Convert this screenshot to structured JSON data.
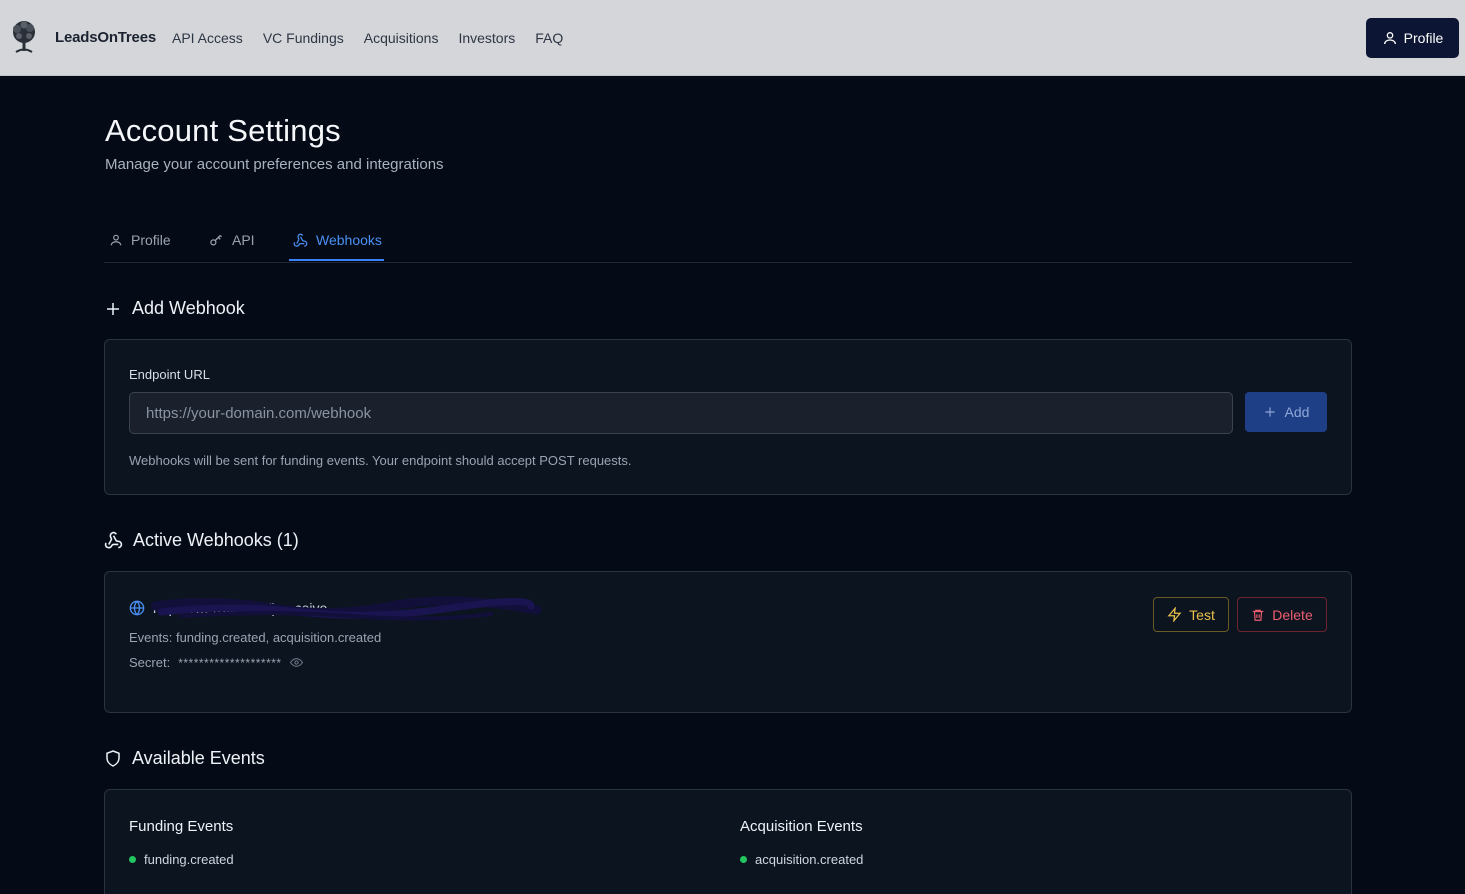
{
  "nav": {
    "brand": "LeadsOnTrees",
    "links": [
      "API Access",
      "VC Fundings",
      "Acquisitions",
      "Investors",
      "FAQ"
    ],
    "profile_label": "Profile"
  },
  "header": {
    "title": "Account Settings",
    "subtitle": "Manage your account preferences and integrations"
  },
  "tabs": [
    {
      "label": "Profile",
      "icon": "user-icon"
    },
    {
      "label": "API",
      "icon": "key-icon"
    },
    {
      "label": "Webhooks",
      "icon": "webhook-icon",
      "active": true
    }
  ],
  "add_webhook": {
    "heading": "Add Webhook",
    "field_label": "Endpoint URL",
    "placeholder": "https://your-domain.com/webhook",
    "value": "",
    "add_label": "Add",
    "help": "Webhooks will be sent for funding events. Your endpoint should accept POST requests."
  },
  "active": {
    "heading": "Active Webhooks (1)",
    "webhooks": [
      {
        "url": "https://… (redacted) …ceive",
        "events": "Events: funding.created, acquisition.created",
        "secret_label": "Secret:",
        "secret_mask": "********************",
        "test_label": "Test",
        "delete_label": "Delete"
      }
    ]
  },
  "available": {
    "heading": "Available Events",
    "columns": [
      {
        "title": "Funding Events",
        "items": [
          "funding.created"
        ]
      },
      {
        "title": "Acquisition Events",
        "items": [
          "acquisition.created"
        ]
      }
    ]
  },
  "colors": {
    "accent": "#3b82f6",
    "background": "#050b16",
    "card": "#0c1420",
    "success_dot": "#22c55e",
    "warning": "#e9c04a",
    "danger": "#ee5d6e"
  }
}
